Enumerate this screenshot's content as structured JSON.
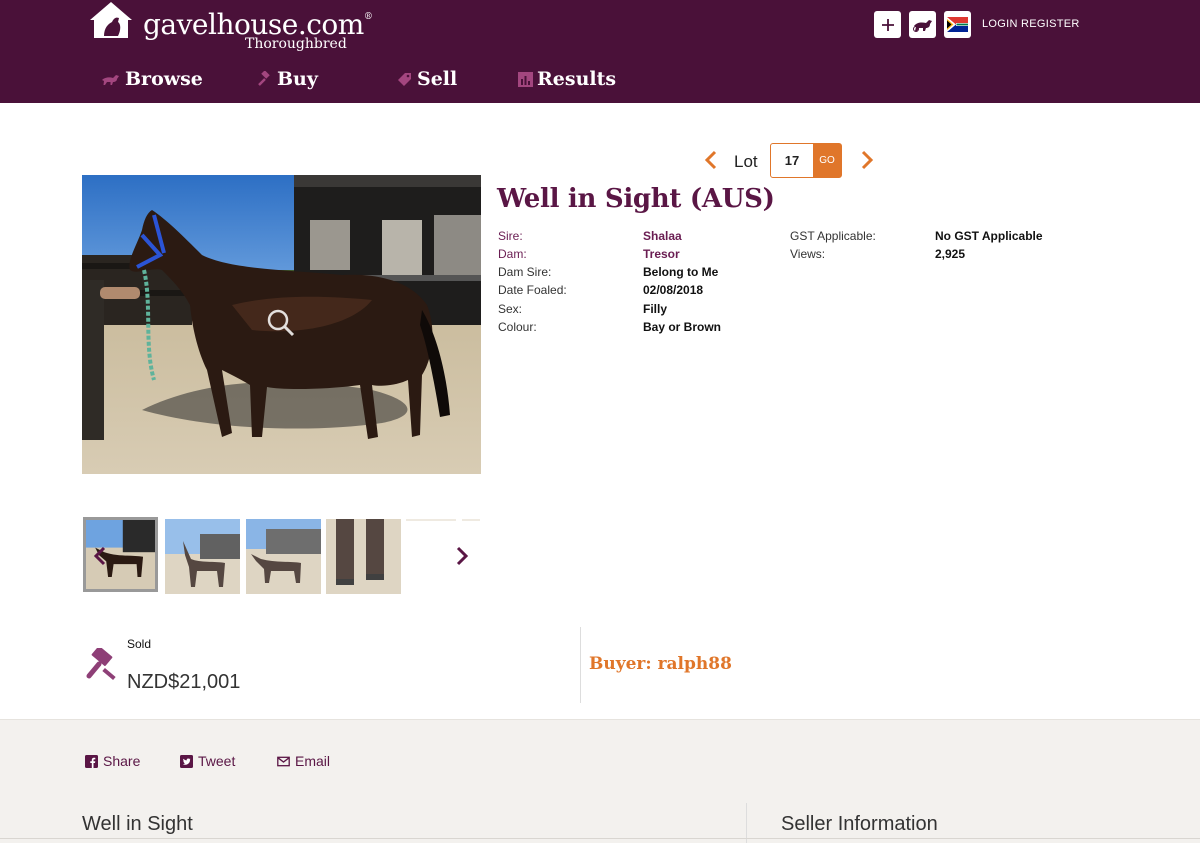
{
  "header": {
    "logo_text": "gavelhouse.com",
    "logo_reg": "®",
    "logo_sub": "Thoroughbred",
    "login": "LOGIN",
    "register": "REGISTER",
    "icons": [
      "plus-icon",
      "harness-horse-icon",
      "south-africa-flag-icon"
    ],
    "nav": [
      {
        "label": "Browse",
        "icon": "horse-icon"
      },
      {
        "label": "Buy",
        "icon": "gavel-icon"
      },
      {
        "label": "Sell",
        "icon": "tag-icon"
      },
      {
        "label": "Results",
        "icon": "bar-chart-icon"
      }
    ]
  },
  "lot": {
    "label": "Lot",
    "value": "17",
    "go": "GO"
  },
  "horse": {
    "title": "Well in Sight (AUS)",
    "details_left": [
      {
        "label": "Sire:",
        "value": "Shalaa",
        "highlight": true
      },
      {
        "label": "Dam:",
        "value": "Tresor",
        "highlight": true
      },
      {
        "label": "Dam Sire:",
        "value": "Belong to Me",
        "highlight": false
      },
      {
        "label": "Date Foaled:",
        "value": "02/08/2018",
        "highlight": false
      },
      {
        "label": "Sex:",
        "value": "Filly",
        "highlight": false
      },
      {
        "label": "Colour:",
        "value": "Bay or Brown",
        "highlight": false
      }
    ],
    "details_right": [
      {
        "label": "GST Applicable:",
        "value": "No GST Applicable"
      },
      {
        "label": "Views:",
        "value": "2,925"
      }
    ]
  },
  "sale": {
    "status": "Sold",
    "price": "NZD$21,001",
    "buyer": "Buyer: ralph88"
  },
  "share": {
    "facebook": "Share",
    "twitter": "Tweet",
    "email": "Email"
  },
  "sections": {
    "left": "Well in Sight",
    "right": "Seller Information"
  },
  "colors": {
    "brand_purple": "#4a1139",
    "accent_orange": "#e0762a",
    "title_purple": "#5a1645"
  }
}
